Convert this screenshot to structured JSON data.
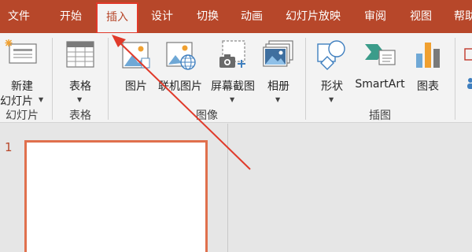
{
  "tabs": [
    {
      "id": "file",
      "label": "文件"
    },
    {
      "id": "home",
      "label": "开始"
    },
    {
      "id": "insert",
      "label": "插入",
      "active": true
    },
    {
      "id": "design",
      "label": "设计"
    },
    {
      "id": "transitions",
      "label": "切换"
    },
    {
      "id": "animations",
      "label": "动画"
    },
    {
      "id": "slideshow",
      "label": "幻灯片放映"
    },
    {
      "id": "review",
      "label": "审阅"
    },
    {
      "id": "view",
      "label": "视图"
    },
    {
      "id": "help",
      "label": "帮助"
    }
  ],
  "ribbon": {
    "new_slide": {
      "line1": "新建",
      "line2": "幻灯片"
    },
    "table": {
      "label": "表格"
    },
    "picture": {
      "label": "图片"
    },
    "online_picture": {
      "label": "联机图片"
    },
    "screenshot": {
      "label": "屏幕截图"
    },
    "album": {
      "label": "相册"
    },
    "shapes": {
      "label": "形状"
    },
    "smartart": {
      "label": "SmartArt"
    },
    "chart": {
      "label": "图表"
    },
    "groups": {
      "slides": "幻灯片",
      "tables": "表格",
      "images": "图像",
      "illustrations": "插图"
    }
  },
  "slides_pane": {
    "slide_number": "1"
  },
  "colors": {
    "accent": "#b7472a",
    "highlight": "#e03a2a",
    "ribbon_bg": "#f3f3f3",
    "slide_border": "#e0704d"
  }
}
